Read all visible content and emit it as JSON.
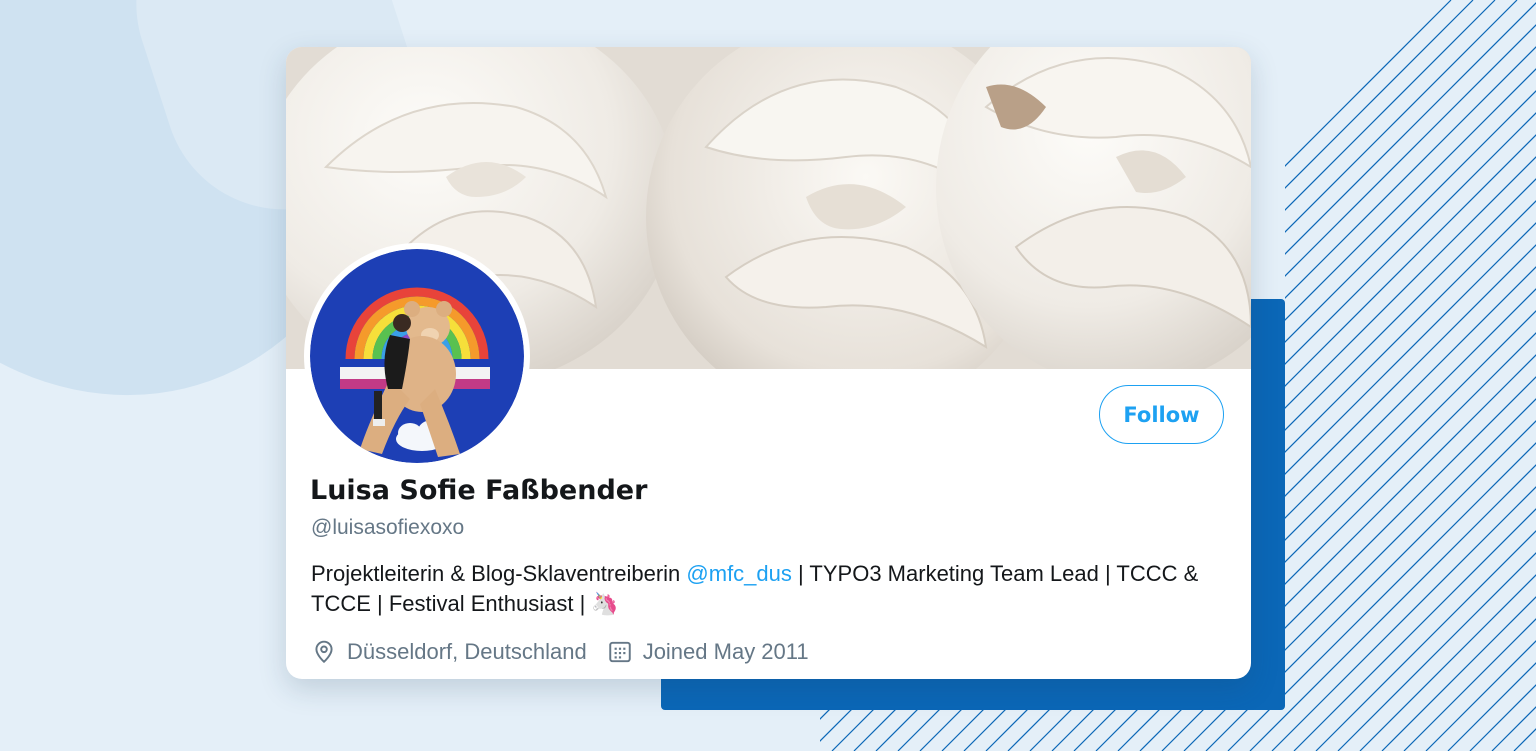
{
  "profile": {
    "display_name": "Luisa Sofie Faßbender",
    "handle": "@luisasofiexoxo",
    "bio": {
      "part1": "Projektleiterin & Blog-Sklaventreiberin ",
      "mention": "@mfc_dus",
      "part2": " | TYPO3 Marketing Team Lead | TCCC & TCCE | Festival Enthusiast | ",
      "emoji": "🦄"
    },
    "location": "Düsseldorf, Deutschland",
    "joined": "Joined May 2011",
    "follow_label": "Follow"
  },
  "icons": {
    "location": "location-pin-icon",
    "calendar": "calendar-icon",
    "emoji": "unicorn-emoji-icon"
  },
  "colors": {
    "accent": "#1da1f2",
    "background": "#e4eff8",
    "blue_block": "#0b67b7",
    "name": "#14171a",
    "muted": "#657786"
  }
}
